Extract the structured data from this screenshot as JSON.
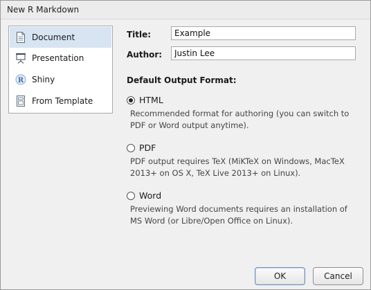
{
  "window": {
    "title": "New R Markdown"
  },
  "sidebar": {
    "items": [
      {
        "label": "Document",
        "icon": "document-icon",
        "selected": true
      },
      {
        "label": "Presentation",
        "icon": "presentation-icon",
        "selected": false
      },
      {
        "label": "Shiny",
        "icon": "shiny-r-icon",
        "selected": false
      },
      {
        "label": "From Template",
        "icon": "template-icon",
        "selected": false
      }
    ]
  },
  "form": {
    "title_label": "Title:",
    "title_value": "Example",
    "author_label": "Author:",
    "author_value": "Justin Lee"
  },
  "output": {
    "heading": "Default Output Format:",
    "options": [
      {
        "label": "HTML",
        "selected": true,
        "description": "Recommended format for authoring (you can switch to PDF or Word output anytime)."
      },
      {
        "label": "PDF",
        "selected": false,
        "description": "PDF output requires TeX (MiKTeX on Windows, MacTeX 2013+ on OS X, TeX Live 2013+ on Linux)."
      },
      {
        "label": "Word",
        "selected": false,
        "description": "Previewing Word documents requires an installation of MS Word (or Libre/Open Office on Linux)."
      }
    ]
  },
  "buttons": {
    "ok": "OK",
    "cancel": "Cancel"
  },
  "colors": {
    "selection": "#d7e4f2",
    "dialog_bg": "#f0f0f0",
    "accent": "#3a6fb0"
  }
}
